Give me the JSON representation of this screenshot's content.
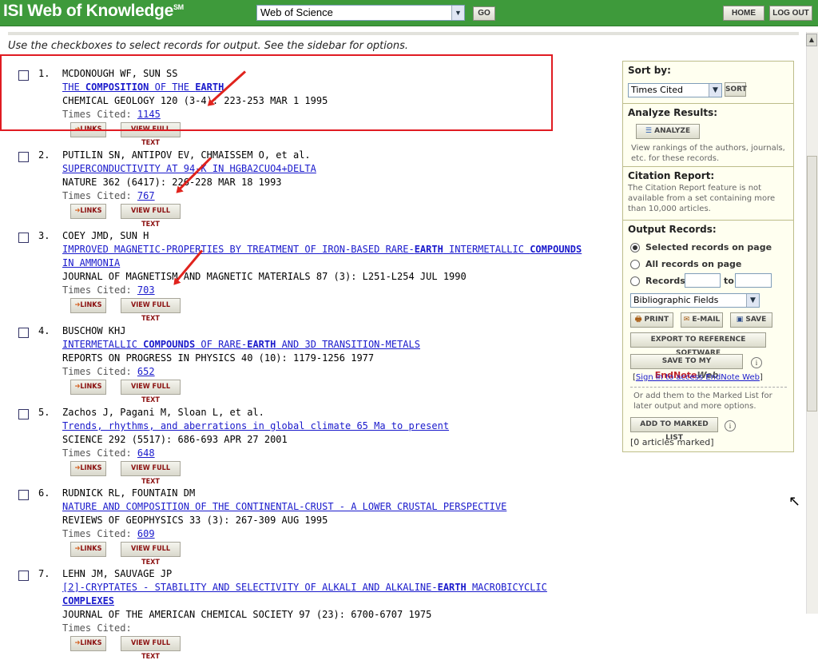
{
  "header": {
    "brand": "ISI Web of Knowledge",
    "brand_mark": "SM",
    "database": "Web of Science",
    "go_label": "GO",
    "home_label": "HOME",
    "logout_label": "LOG OUT"
  },
  "instructions": "Use the checkboxes to select records for output. See the sidebar for options.",
  "records": [
    {
      "num": "1.",
      "authors": "MCDONOUGH WF, SUN SS",
      "title_parts": [
        [
          "THE ",
          false
        ],
        [
          "COMPOSITION",
          true
        ],
        [
          " OF THE ",
          false
        ],
        [
          "EARTH",
          true
        ]
      ],
      "source": "CHEMICAL GEOLOGY 120 (3-4): 223-253 MAR 1 1995",
      "times_cited_label": "Times Cited:",
      "times_cited": "1145"
    },
    {
      "num": "2.",
      "authors": "PUTILIN SN, ANTIPOV EV, CHMAISSEM O, et al.",
      "title_parts": [
        [
          "SUPERCONDUCTIVITY AT 94-K IN HGBA2CUO4+DELTA",
          false
        ]
      ],
      "source": "NATURE 362 (6417): 226-228 MAR 18 1993",
      "times_cited_label": "Times Cited:",
      "times_cited": "767"
    },
    {
      "num": "3.",
      "authors": "COEY JMD, SUN H",
      "title_parts": [
        [
          "IMPROVED MAGNETIC-PROPERTIES BY TREATMENT OF IRON-BASED RARE-",
          false
        ],
        [
          "EARTH",
          true
        ],
        [
          " INTERMETALLIC ",
          false
        ],
        [
          "COMPOUNDS",
          true
        ],
        [
          " IN AMMONIA",
          false
        ]
      ],
      "source": "JOURNAL OF MAGNETISM AND MAGNETIC MATERIALS 87 (3): L251-L254 JUL 1990",
      "times_cited_label": "Times Cited:",
      "times_cited": "703"
    },
    {
      "num": "4.",
      "authors": "BUSCHOW KHJ",
      "title_parts": [
        [
          "INTERMETALLIC ",
          false
        ],
        [
          "COMPOUNDS",
          true
        ],
        [
          " OF RARE-",
          false
        ],
        [
          "EARTH",
          true
        ],
        [
          " AND 3D TRANSITION-METALS",
          false
        ]
      ],
      "source": "REPORTS ON PROGRESS IN PHYSICS 40 (10): 1179-1256 1977",
      "times_cited_label": "Times Cited:",
      "times_cited": "652"
    },
    {
      "num": "5.",
      "authors": "Zachos J, Pagani M, Sloan L, et al.",
      "title_parts": [
        [
          "Trends, rhythms, and aberrations in global climate 65 Ma to present",
          false
        ]
      ],
      "source": "SCIENCE 292 (5517): 686-693 APR 27 2001",
      "times_cited_label": "Times Cited:",
      "times_cited": "648"
    },
    {
      "num": "6.",
      "authors": "RUDNICK RL, FOUNTAIN DM",
      "title_parts": [
        [
          "NATURE AND COMPOSITION OF THE CONTINENTAL-CRUST - A LOWER CRUSTAL PERSPECTIVE",
          false
        ]
      ],
      "source": "REVIEWS OF GEOPHYSICS 33 (3): 267-309 AUG 1995",
      "times_cited_label": "Times Cited:",
      "times_cited": "609"
    },
    {
      "num": "7.",
      "authors": "LEHN JM, SAUVAGE JP",
      "title_parts": [
        [
          "[2]-CRYPTATES - STABILITY AND SELECTIVITY OF ALKALI AND ALKALINE-",
          false
        ],
        [
          "EARTH",
          true
        ],
        [
          " MACROBICYCLIC ",
          false
        ],
        [
          "COMPLEXES",
          true
        ]
      ],
      "source": "JOURNAL OF THE AMERICAN CHEMICAL SOCIETY 97 (23): 6700-6707 1975",
      "times_cited_label": "Times Cited:",
      "times_cited": ""
    }
  ],
  "record_buttons": {
    "links": "LINKS",
    "full_text": "VIEW FULL TEXT"
  },
  "sidebar": {
    "sort_title": "Sort by:",
    "sort_value": "Times Cited",
    "sort_button": "SORT",
    "analyze_title": "Analyze Results:",
    "analyze_button": "ANALYZE",
    "analyze_text": "View rankings of the authors, journals, etc. for these records.",
    "citation_title": "Citation Report:",
    "citation_text": "The Citation Report feature is not available from a set containing more than 10,000 articles.",
    "output_title": "Output Records:",
    "opt_selected": "Selected records on page",
    "opt_all": "All records on page",
    "opt_records": "Records",
    "opt_to": "to",
    "fields_value": "Bibliographic Fields",
    "print_label": "PRINT",
    "email_label": "E-MAIL",
    "save_label": "SAVE",
    "export_label": "EXPORT TO REFERENCE SOFTWARE",
    "endnote_prefix": "SAVE TO MY",
    "endnote_brand": "EndNote",
    "endnote_web": "Web",
    "signin_link": "Sign in to access EndNote Web",
    "marked_text": "Or add them to the Marked List for later output and more options.",
    "add_marked": "ADD TO MARKED LIST",
    "marked_count": "[0 articles marked]"
  }
}
